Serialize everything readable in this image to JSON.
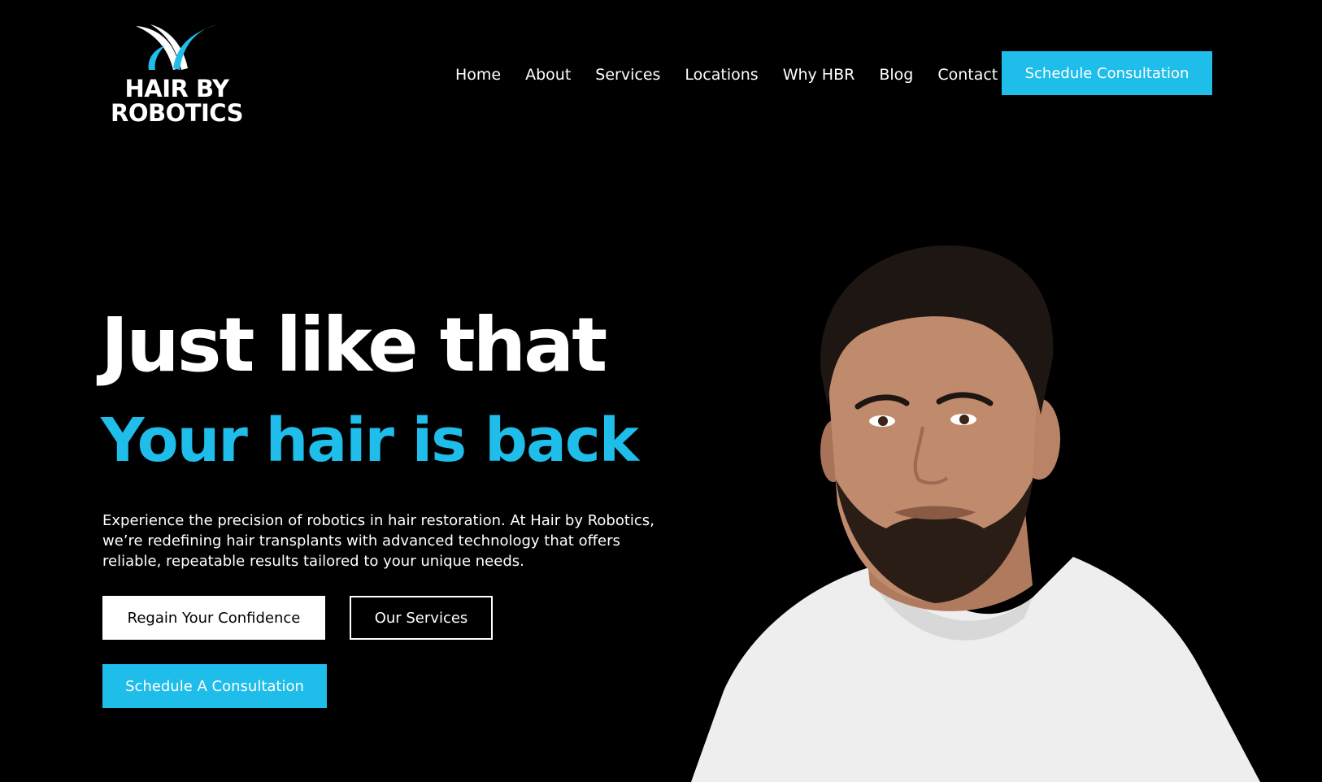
{
  "brand": {
    "logo_line1": "HAIR BY",
    "logo_line2": "ROBOTICS",
    "accent_color": "#1fbdea"
  },
  "nav": {
    "items": [
      {
        "label": "Home"
      },
      {
        "label": "About"
      },
      {
        "label": "Services"
      },
      {
        "label": "Locations"
      },
      {
        "label": "Why HBR"
      },
      {
        "label": "Blog"
      },
      {
        "label": "Contact"
      }
    ],
    "cta_label": "Schedule Consultation"
  },
  "hero": {
    "headline": "Just like that",
    "subheadline": "Your hair is back",
    "description": "Experience the precision of robotics in hair restoration. At Hair by Robotics, we’re redefining hair transplants with advanced technology that offers reliable, repeatable results tailored to your unique needs.",
    "buttons": {
      "primary_label": "Regain Your Confidence",
      "secondary_label": "Our Services",
      "consult_label": "Schedule A Consultation"
    }
  }
}
